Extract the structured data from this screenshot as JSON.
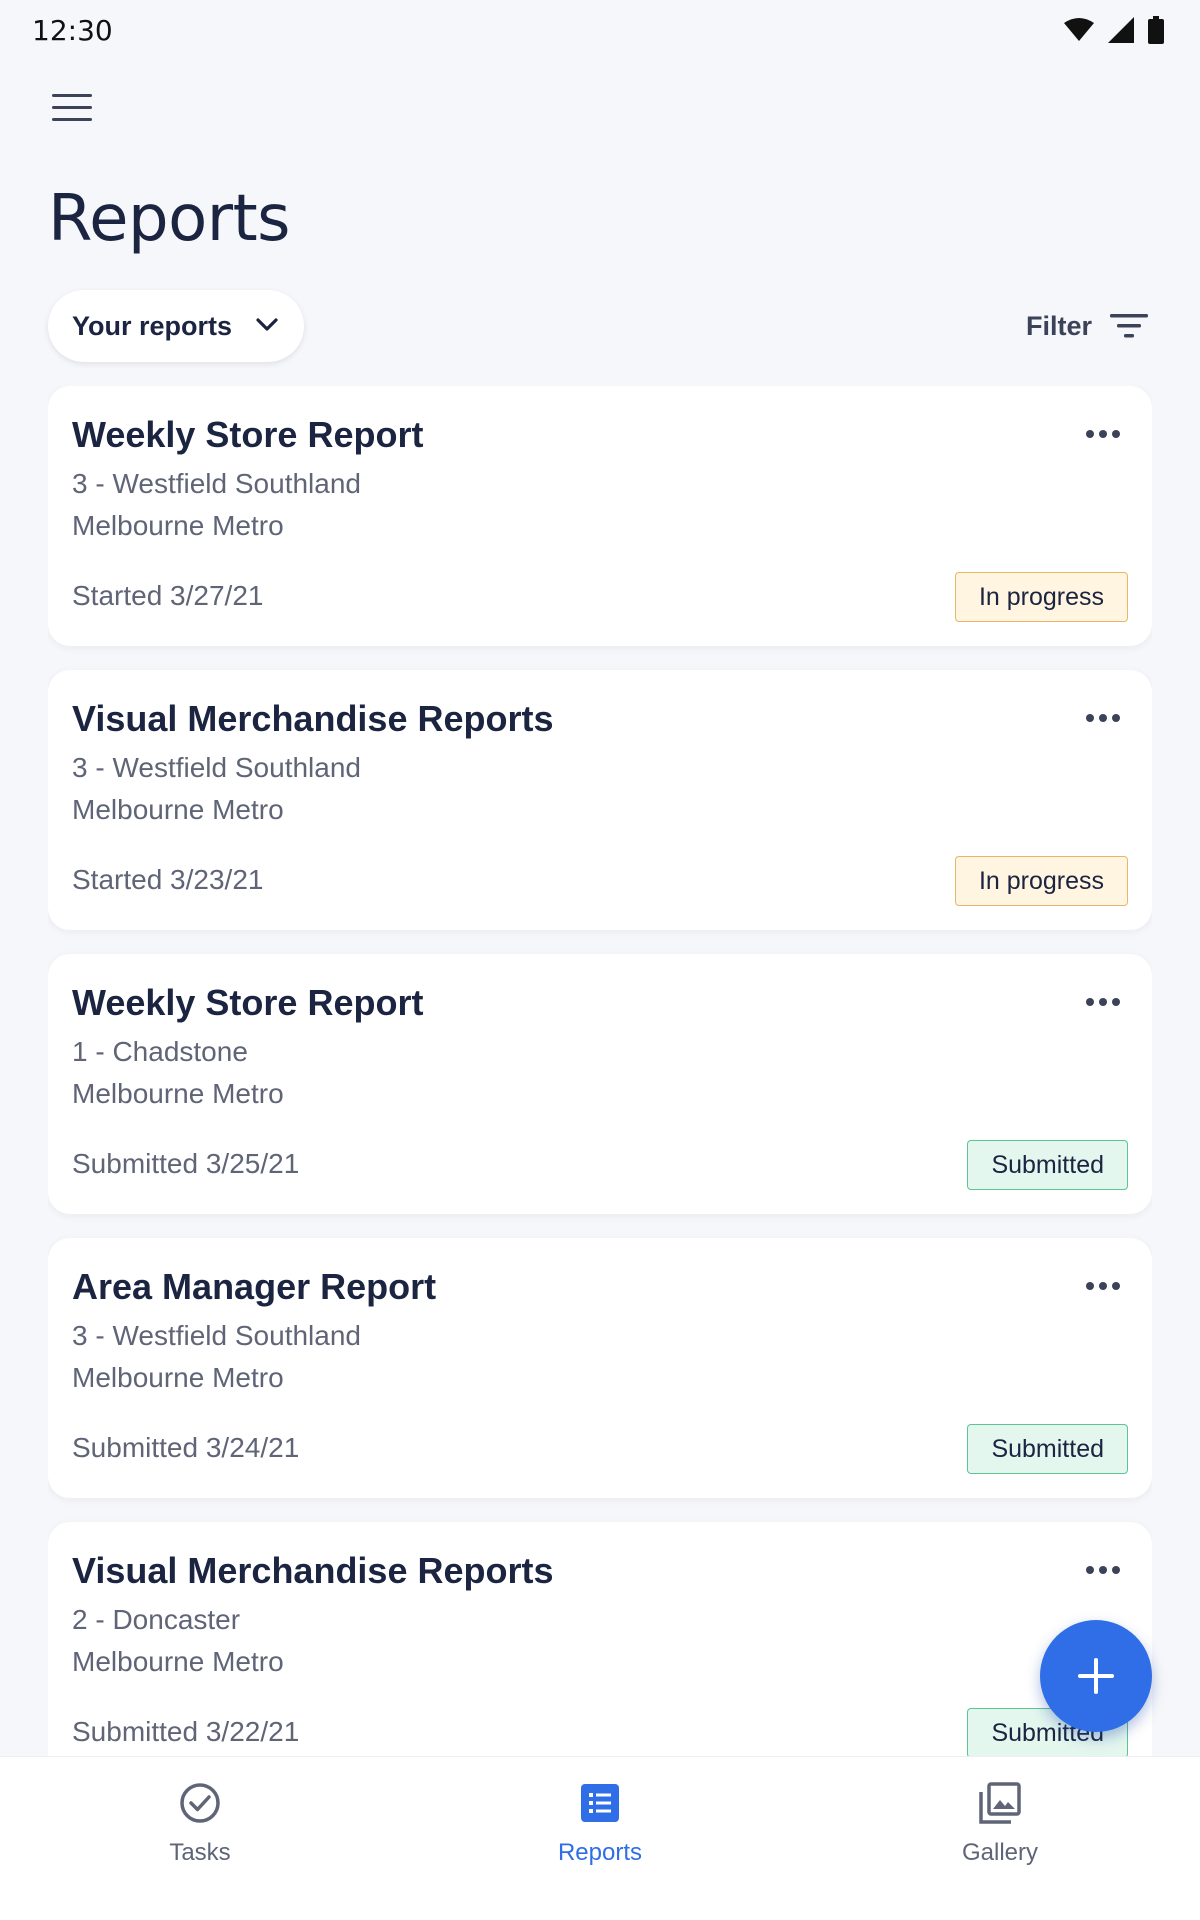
{
  "status_bar": {
    "time": "12:30"
  },
  "header": {
    "title": "Reports"
  },
  "toolbar": {
    "scope_label": "Your reports",
    "filter_label": "Filter"
  },
  "reports": [
    {
      "title": "Weekly Store Report",
      "store": "3 - Westfield Southland",
      "region": "Melbourne Metro",
      "date": "Started 3/27/21",
      "status": "In progress",
      "status_type": "progress"
    },
    {
      "title": "Visual Merchandise Reports",
      "store": "3 - Westfield Southland",
      "region": "Melbourne Metro",
      "date": "Started 3/23/21",
      "status": "In progress",
      "status_type": "progress"
    },
    {
      "title": "Weekly Store Report",
      "store": "1 - Chadstone",
      "region": "Melbourne Metro",
      "date": "Submitted 3/25/21",
      "status": "Submitted",
      "status_type": "submitted"
    },
    {
      "title": "Area Manager Report",
      "store": "3 - Westfield Southland",
      "region": "Melbourne Metro",
      "date": "Submitted 3/24/21",
      "status": "Submitted",
      "status_type": "submitted"
    },
    {
      "title": "Visual Merchandise Reports",
      "store": "2 - Doncaster",
      "region": "Melbourne Metro",
      "date": "Submitted 3/22/21",
      "status": "Submitted",
      "status_type": "submitted"
    }
  ],
  "bottom_nav": {
    "items": [
      {
        "label": "Tasks",
        "icon": "check-circle-icon",
        "active": false
      },
      {
        "label": "Reports",
        "icon": "list-icon",
        "active": true
      },
      {
        "label": "Gallery",
        "icon": "gallery-icon",
        "active": false
      }
    ]
  },
  "colors": {
    "accent": "#2f6ee6",
    "in_progress_bg": "#fff5e0",
    "submitted_bg": "#e3f7ee"
  }
}
